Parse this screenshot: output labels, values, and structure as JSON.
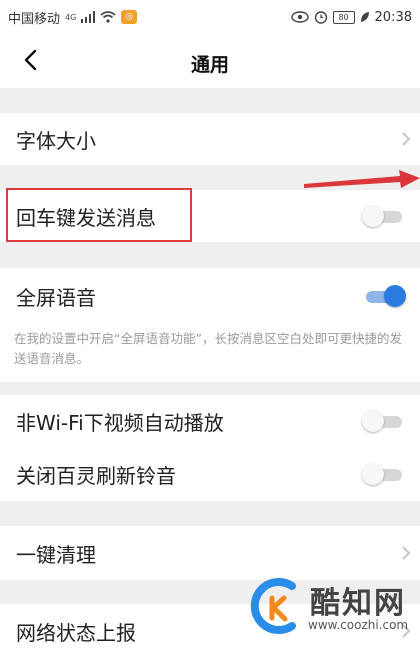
{
  "status_bar": {
    "carrier": "中国移动",
    "network": "4G",
    "battery": "80",
    "time": "20:38"
  },
  "header": {
    "title": "通用",
    "back_icon": "chevron-left-icon"
  },
  "settings": {
    "font_size": {
      "label": "字体大小"
    },
    "enter_to_send": {
      "label": "回车键发送消息",
      "enabled": false
    },
    "fullscreen_voice": {
      "label": "全屏语音",
      "enabled": true,
      "note": "在我的设置中开启“全屏语音功能”，长按消息区空白处即可更快捷的发送语音消息。"
    },
    "autoplay_video": {
      "label": "非Wi-Fi下视频自动播放",
      "enabled": false
    },
    "refresh_sound": {
      "label": "关闭百灵刷新铃音",
      "enabled": false
    },
    "clear_cache": {
      "label": "一键清理"
    },
    "network_report": {
      "label": "网络状态上报"
    }
  },
  "watermark": {
    "brand": "酷知网",
    "url": "www.coozhi.com"
  },
  "colors": {
    "toggle_on": "#2a7be0",
    "highlight_box": "#e0393e",
    "annotation_arrow": "#d9373c"
  }
}
